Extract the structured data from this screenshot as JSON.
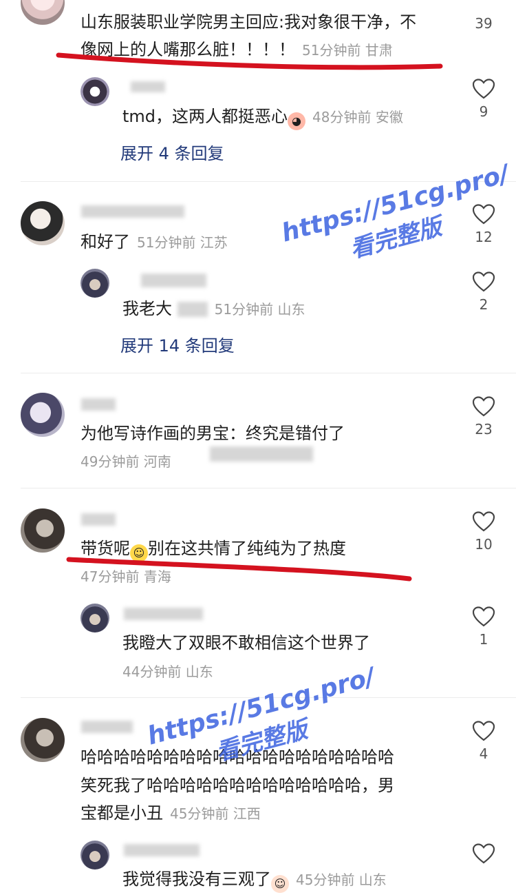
{
  "comments": [
    {
      "text": "山东服装职业学院男主回应:我对象很干净，不",
      "text2": "像网上的人嘴那么脏！！！！",
      "meta": "51分钟前 甘肃",
      "likes": "39"
    },
    {
      "text": "tmd，这两人都挺恶心",
      "meta": "48分钟前 安徽",
      "likes": "9",
      "expand": "展开 4 条回复"
    },
    {
      "text": "和好了",
      "meta": "51分钟前 江苏",
      "likes": "12"
    },
    {
      "text": "我老大 ",
      "meta": "51分钟前 山东",
      "likes": "2",
      "expand": "展开 14 条回复"
    },
    {
      "text": "为他写诗作画的男宝：终究是错付了",
      "meta": "49分钟前 河南",
      "likes": "23"
    },
    {
      "text": "带货呢",
      "text2": "别在这共情了纯纯为了热度",
      "meta": "47分钟前 青海",
      "likes": "10"
    },
    {
      "text": "我瞪大了双眼不敢相信这个世界了",
      "meta": "44分钟前 山东",
      "likes": "1"
    },
    {
      "text": "哈哈哈哈哈哈哈哈哈哈哈哈哈哈哈哈哈哈哈",
      "text2": "笑死我了哈哈哈哈哈哈哈哈哈哈哈哈哈，男",
      "text3": "宝都是小丑",
      "meta": "45分钟前 江西",
      "likes": "4"
    },
    {
      "text": "我觉得我没有三观了",
      "meta": "45分钟前 山东",
      "likes": ""
    }
  ],
  "watermark": {
    "url": "https://51cg.pro/",
    "cn": "看完整版"
  },
  "icons": {
    "like": "heart-outline-icon",
    "emoji_grin": "grinning-sweat-emoji",
    "emoji_peach": "peach-emoji"
  },
  "colors": {
    "annotation": "#d4121f",
    "watermark": "#3d63e0",
    "link": "#223a7a"
  }
}
